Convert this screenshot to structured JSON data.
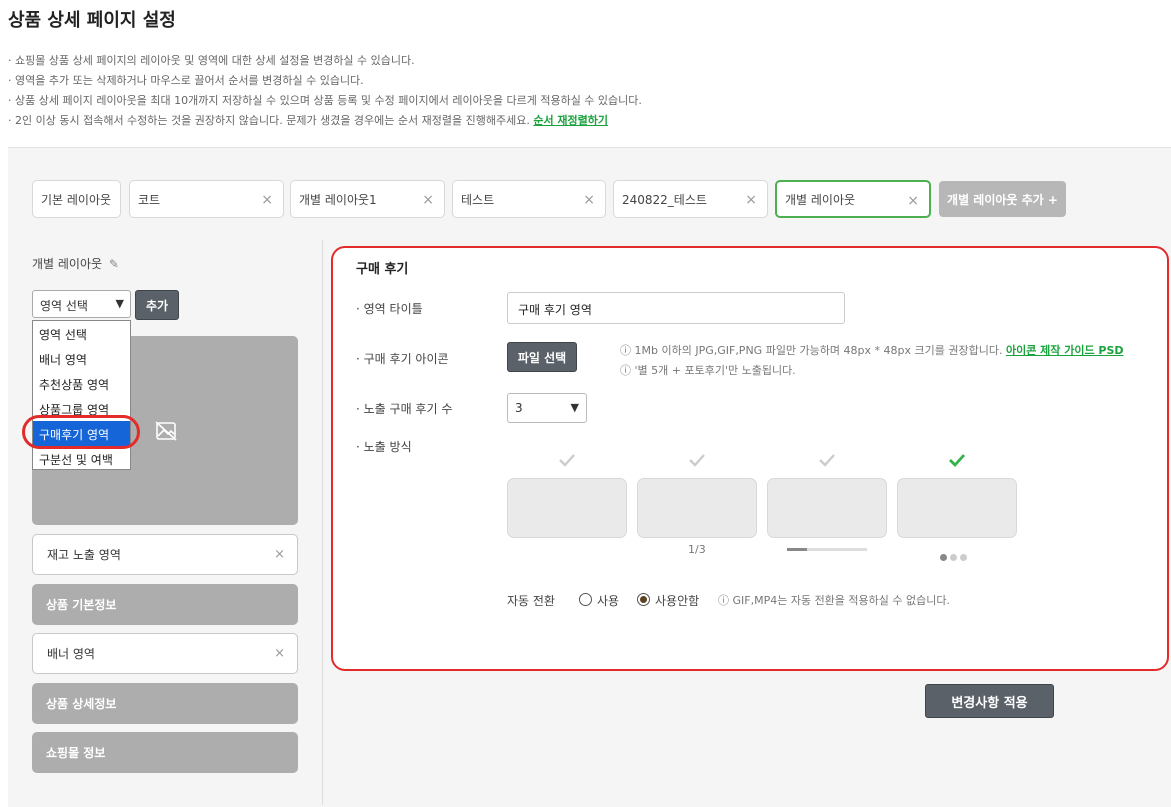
{
  "page": {
    "title": "상품 상세 페이지 설정",
    "notes": [
      "· 쇼핑몰 상품 상세 페이지의 레이아웃 및 영역에 대한 상세 설정을 변경하실 수 있습니다.",
      "· 영역을 추가 또는 삭제하거나 마우스로 끌어서 순서를 변경하실 수 있습니다.",
      "· 상품 상세 페이지 레이아웃을 최대 10개까지 저장하실 수 있으며 상품 등록 및 수정 페이지에서 레이아웃을 다르게 적용하실 수 있습니다.",
      "· 2인 이상 동시 접속해서 수정하는 것을 권장하지 않습니다. 문제가 생겼을 경우에는 순서 재정렬을 진행해주세요."
    ],
    "reorder_link": "순서 재정렬하기"
  },
  "tabs": [
    {
      "label": "기본 레이아웃",
      "closable": false
    },
    {
      "label": "코트",
      "closable": true
    },
    {
      "label": "개별 레이아웃1",
      "closable": true
    },
    {
      "label": "테스트",
      "closable": true
    },
    {
      "label": "240822_테스트",
      "closable": true
    },
    {
      "label": "개별 레이아웃",
      "closable": true,
      "active": true
    }
  ],
  "tab_add_label": "개별 레이아웃 추가 +",
  "close_glyph": "×",
  "left": {
    "layout_name": "개별 레이아웃",
    "select_value": "영역 선택",
    "add_label": "추가",
    "dropdown_options": [
      "영역 선택",
      "배너 영역",
      "추천상품 영역",
      "상품그룹 영역",
      "구매후기 영역",
      "구분선 및 여백"
    ],
    "selected_option": "구매후기 영역",
    "areas": [
      {
        "label": "재고 노출 영역",
        "style": "white"
      },
      {
        "label": "상품 기본정보",
        "style": "gray"
      },
      {
        "label": "배너 영역",
        "style": "white"
      },
      {
        "label": "상품 상세정보",
        "style": "gray"
      },
      {
        "label": "쇼핑몰 정보",
        "style": "gray"
      }
    ]
  },
  "settings": {
    "section_title": "구매 후기",
    "title_label": "· 영역 타이틀",
    "title_value": "구매 후기 영역",
    "icon_label": "· 구매 후기 아이콘",
    "file_button": "파일 선택",
    "icon_hint1": "ⓘ 1Mb 이하의 JPG,GIF,PNG 파일만 가능하며 48px * 48px 크기를 권장합니다.",
    "icon_guide_link": "아이콘 제작 가이드 PSD",
    "icon_hint2": "ⓘ '별 5개 + 포토후기'만 노출됩니다.",
    "count_label": "· 노출 구매 후기 수",
    "count_value": "3",
    "display_label": "· 노출 방식",
    "selected_display_option": 4,
    "pager_text": "1/3",
    "auto_label": "자동 전환",
    "radio_use": "사용",
    "radio_nouse": "사용안함",
    "auto_selected": "사용안함",
    "auto_hint": "ⓘ GIF,MP4는 자동 전환을 적용하실 수 없습니다."
  },
  "apply_label": "변경사항 적용",
  "colors": {
    "accent_green": "#4caf50",
    "highlight_red": "#e32b2b",
    "dark_button": "#5a6169",
    "selected_blue": "#1565d8"
  }
}
